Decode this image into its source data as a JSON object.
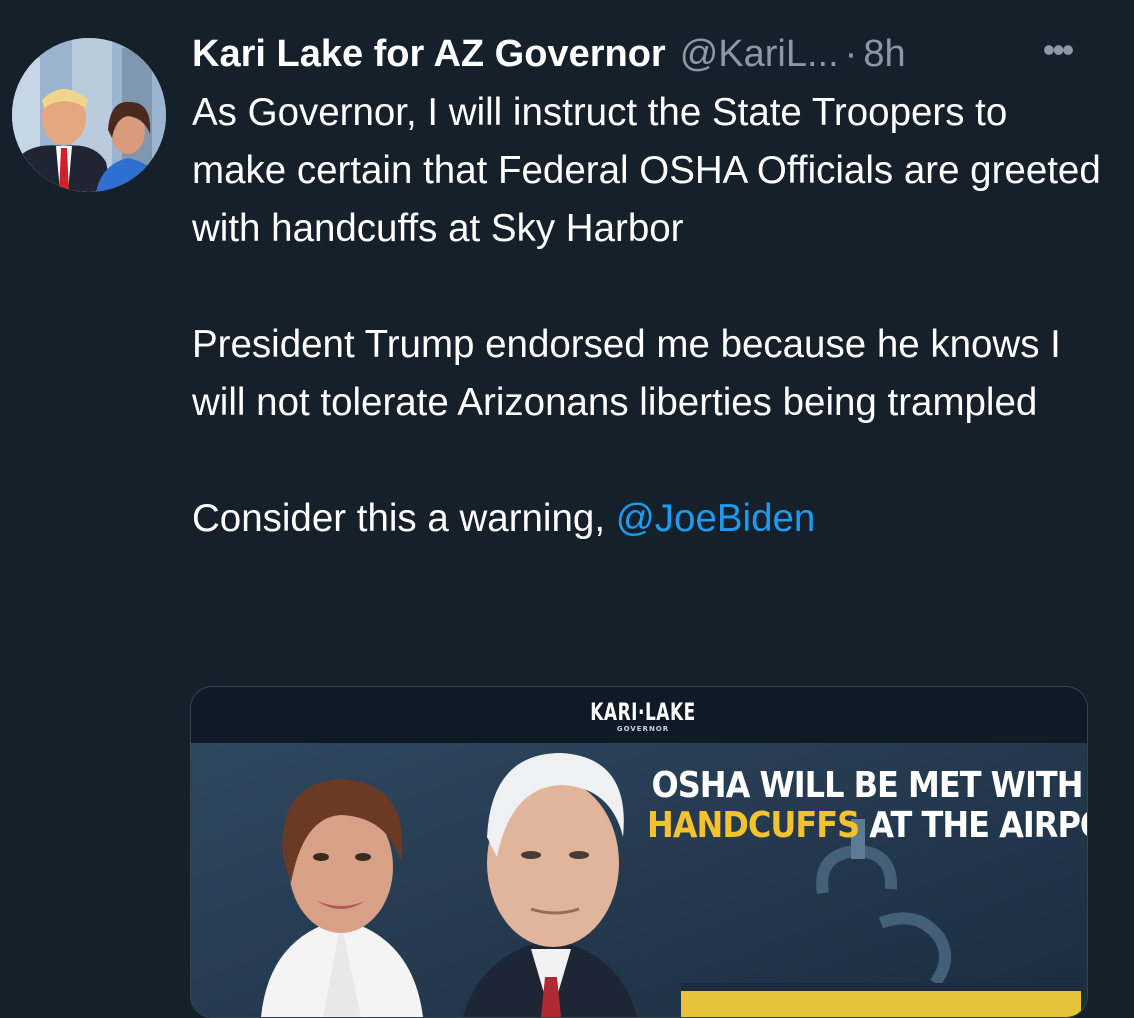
{
  "tweet": {
    "author_name": "Kari Lake for AZ Governor",
    "handle": "@KariL...",
    "separator": "·",
    "time": "8h",
    "more_label": "•••",
    "paragraph1": "As Governor, I will instruct the State Troopers to make certain that Federal OSHA Officials are greeted with handcuffs at Sky Harbor",
    "paragraph2": "President Trump endorsed me because he knows I will not tolerate Arizonans liberties being trampled",
    "paragraph3_text": "Consider this a warning, ",
    "mention": "@JoeBiden"
  },
  "media": {
    "logo_main": "KARI·LAKE",
    "logo_sub": "GOVERNOR",
    "headline_line1": "OSHA WILL BE MET WITH",
    "headline_highlight": "HANDCUFFS",
    "headline_line2_rest": " AT THE AIRPORT"
  },
  "colors": {
    "background": "#15202b",
    "secondary_text": "#8b98a5",
    "link": "#1d9bf0",
    "highlight": "#f2c230"
  }
}
